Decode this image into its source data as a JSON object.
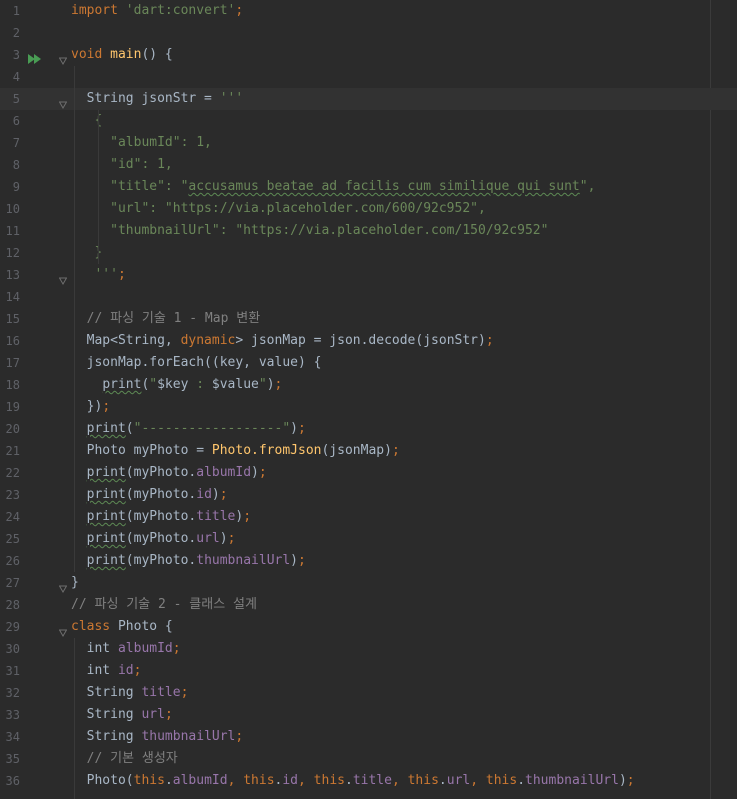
{
  "editor": {
    "lines": [
      {
        "n": "1",
        "t": [
          {
            "s": "import ",
            "c": "kw"
          },
          {
            "s": "'dart:convert'",
            "c": "str"
          },
          {
            "s": ";",
            "c": "kw"
          }
        ]
      },
      {
        "n": "2",
        "t": []
      },
      {
        "n": "3",
        "run": true,
        "fold": true,
        "t": [
          {
            "s": "void ",
            "c": "kw"
          },
          {
            "s": "main",
            "c": "fn"
          },
          {
            "s": "() {"
          }
        ]
      },
      {
        "n": "4",
        "t": []
      },
      {
        "n": "5",
        "current": true,
        "fold": true,
        "t": [
          {
            "s": "  String jsonStr = "
          },
          {
            "s": "'''",
            "c": "str"
          }
        ]
      },
      {
        "n": "6",
        "t": [
          {
            "s": "   {",
            "c": "str"
          }
        ]
      },
      {
        "n": "7",
        "t": [
          {
            "s": "     \"albumId\": 1,",
            "c": "str"
          }
        ]
      },
      {
        "n": "8",
        "t": [
          {
            "s": "     \"id\": 1,",
            "c": "str"
          }
        ]
      },
      {
        "n": "9",
        "t": [
          {
            "s": "     \"title\": \"",
            "c": "str"
          },
          {
            "s": "accusamus beatae ad facilis cum similique qui sunt",
            "c": "str typo"
          },
          {
            "s": "\",",
            "c": "str"
          }
        ]
      },
      {
        "n": "10",
        "t": [
          {
            "s": "     \"url\": \"https://via.placeholder.com/600/92c952\",",
            "c": "str"
          }
        ]
      },
      {
        "n": "11",
        "t": [
          {
            "s": "     \"thumbnailUrl\": \"https://via.placeholder.com/150/92c952\"",
            "c": "str"
          }
        ]
      },
      {
        "n": "12",
        "t": [
          {
            "s": "   }",
            "c": "str"
          }
        ]
      },
      {
        "n": "13",
        "fold": true,
        "t": [
          {
            "s": "   '''",
            "c": "str"
          },
          {
            "s": ";",
            "c": "kw"
          }
        ]
      },
      {
        "n": "14",
        "t": []
      },
      {
        "n": "15",
        "t": [
          {
            "s": "  // 파싱 기술 1 - Map 변환",
            "c": "cmt"
          }
        ]
      },
      {
        "n": "16",
        "t": [
          {
            "s": "  Map<String, "
          },
          {
            "s": "dynamic",
            "c": "kw"
          },
          {
            "s": "> jsonMap = json.decode(jsonStr)"
          },
          {
            "s": ";",
            "c": "kw"
          }
        ]
      },
      {
        "n": "17",
        "t": [
          {
            "s": "  jsonMap.forEach((key, value) {"
          }
        ]
      },
      {
        "n": "18",
        "t": [
          {
            "s": "    "
          },
          {
            "s": "print",
            "c": "typo"
          },
          {
            "s": "("
          },
          {
            "s": "\"",
            "c": "str"
          },
          {
            "s": "$key"
          },
          {
            "s": " : ",
            "c": "str"
          },
          {
            "s": "$value"
          },
          {
            "s": "\"",
            "c": "str"
          },
          {
            "s": ")"
          },
          {
            "s": ";",
            "c": "kw"
          }
        ]
      },
      {
        "n": "19",
        "t": [
          {
            "s": "  })"
          },
          {
            "s": ";",
            "c": "kw"
          }
        ]
      },
      {
        "n": "20",
        "t": [
          {
            "s": "  "
          },
          {
            "s": "print",
            "c": "typo"
          },
          {
            "s": "("
          },
          {
            "s": "\"------------------\"",
            "c": "str"
          },
          {
            "s": ")"
          },
          {
            "s": ";",
            "c": "kw"
          }
        ]
      },
      {
        "n": "21",
        "t": [
          {
            "s": "  Photo myPhoto = "
          },
          {
            "s": "Photo.",
            "c": "cls"
          },
          {
            "s": "fromJson",
            "c": "fn"
          },
          {
            "s": "(jsonMap)"
          },
          {
            "s": ";",
            "c": "kw"
          }
        ]
      },
      {
        "n": "22",
        "t": [
          {
            "s": "  "
          },
          {
            "s": "print",
            "c": "typo"
          },
          {
            "s": "(myPhoto."
          },
          {
            "s": "albumId",
            "c": "fld"
          },
          {
            "s": ")"
          },
          {
            "s": ";",
            "c": "kw"
          }
        ]
      },
      {
        "n": "23",
        "t": [
          {
            "s": "  "
          },
          {
            "s": "print",
            "c": "typo"
          },
          {
            "s": "(myPhoto."
          },
          {
            "s": "id",
            "c": "fld"
          },
          {
            "s": ")"
          },
          {
            "s": ";",
            "c": "kw"
          }
        ]
      },
      {
        "n": "24",
        "t": [
          {
            "s": "  "
          },
          {
            "s": "print",
            "c": "typo"
          },
          {
            "s": "(myPhoto."
          },
          {
            "s": "title",
            "c": "fld"
          },
          {
            "s": ")"
          },
          {
            "s": ";",
            "c": "kw"
          }
        ]
      },
      {
        "n": "25",
        "t": [
          {
            "s": "  "
          },
          {
            "s": "print",
            "c": "typo"
          },
          {
            "s": "(myPhoto."
          },
          {
            "s": "url",
            "c": "fld"
          },
          {
            "s": ")"
          },
          {
            "s": ";",
            "c": "kw"
          }
        ]
      },
      {
        "n": "26",
        "t": [
          {
            "s": "  "
          },
          {
            "s": "print",
            "c": "typo"
          },
          {
            "s": "(myPhoto."
          },
          {
            "s": "thumbnailUrl",
            "c": "fld"
          },
          {
            "s": ")"
          },
          {
            "s": ";",
            "c": "kw"
          }
        ]
      },
      {
        "n": "27",
        "fold": true,
        "t": [
          {
            "s": "}"
          }
        ]
      },
      {
        "n": "28",
        "t": [
          {
            "s": "// 파싱 기술 2 - 클래스 설계",
            "c": "cmt"
          }
        ]
      },
      {
        "n": "29",
        "fold": true,
        "t": [
          {
            "s": "class ",
            "c": "kw"
          },
          {
            "s": "Photo {"
          }
        ]
      },
      {
        "n": "30",
        "t": [
          {
            "s": "  int "
          },
          {
            "s": "albumId",
            "c": "fld"
          },
          {
            "s": ";",
            "c": "kw"
          }
        ]
      },
      {
        "n": "31",
        "t": [
          {
            "s": "  int "
          },
          {
            "s": "id",
            "c": "fld"
          },
          {
            "s": ";",
            "c": "kw"
          }
        ]
      },
      {
        "n": "32",
        "t": [
          {
            "s": "  String "
          },
          {
            "s": "title",
            "c": "fld"
          },
          {
            "s": ";",
            "c": "kw"
          }
        ]
      },
      {
        "n": "33",
        "t": [
          {
            "s": "  String "
          },
          {
            "s": "url",
            "c": "fld"
          },
          {
            "s": ";",
            "c": "kw"
          }
        ]
      },
      {
        "n": "34",
        "t": [
          {
            "s": "  String "
          },
          {
            "s": "thumbnailUrl",
            "c": "fld"
          },
          {
            "s": ";",
            "c": "kw"
          }
        ]
      },
      {
        "n": "35",
        "t": [
          {
            "s": "  // 기본 생성자",
            "c": "cmt"
          }
        ]
      },
      {
        "n": "36",
        "t": [
          {
            "s": "  Photo("
          },
          {
            "s": "this",
            "c": "kw"
          },
          {
            "s": "."
          },
          {
            "s": "albumId",
            "c": "fld"
          },
          {
            "s": ", ",
            "c": "kw"
          },
          {
            "s": "this",
            "c": "kw"
          },
          {
            "s": "."
          },
          {
            "s": "id",
            "c": "fld"
          },
          {
            "s": ", ",
            "c": "kw"
          },
          {
            "s": "this",
            "c": "kw"
          },
          {
            "s": "."
          },
          {
            "s": "title",
            "c": "fld"
          },
          {
            "s": ", ",
            "c": "kw"
          },
          {
            "s": "this",
            "c": "kw"
          },
          {
            "s": "."
          },
          {
            "s": "url",
            "c": "fld"
          },
          {
            "s": ", ",
            "c": "kw"
          },
          {
            "s": "this",
            "c": "kw"
          },
          {
            "s": "."
          },
          {
            "s": "thumbnailUrl",
            "c": "fld"
          },
          {
            "s": ")"
          },
          {
            "s": ";",
            "c": "kw"
          }
        ]
      }
    ]
  },
  "colors": {
    "background": "#2b2b2b",
    "keyword": "#cc7832",
    "string": "#6a8759",
    "number": "#6897bb",
    "comment": "#808080",
    "field": "#9876aa",
    "function": "#ffc66d",
    "run_marker": "#499c54"
  },
  "icons": {
    "run": "run-icon",
    "fold": "fold-icon"
  }
}
